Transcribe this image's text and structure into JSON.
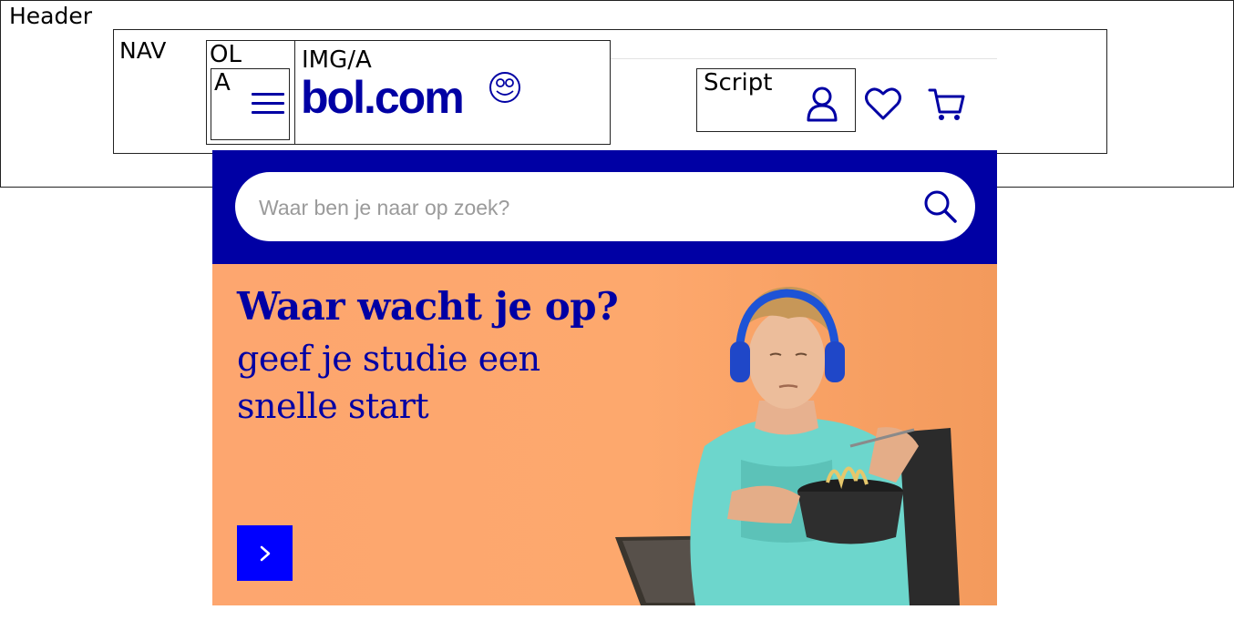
{
  "annotations": {
    "header": "Header",
    "nav": "NAV",
    "ol": "OL",
    "a": "A",
    "img_a": "IMG/A",
    "script": "Script"
  },
  "logo": {
    "text": "bol.com"
  },
  "icons": {
    "menu": "hamburger-menu-icon",
    "account": "user-account-icon",
    "wishlist": "heart-icon",
    "cart": "shopping-cart-icon",
    "search": "magnifier-icon",
    "next": "chevron-right-icon"
  },
  "search": {
    "placeholder": "Waar ben je naar op zoek?"
  },
  "banner": {
    "title": "Waar wacht je op?",
    "subtitle": "geef je studie een snelle start"
  },
  "colors": {
    "brand_blue": "#0000a4",
    "cta_blue": "#0000ff",
    "banner_orange": "#fda66f"
  }
}
